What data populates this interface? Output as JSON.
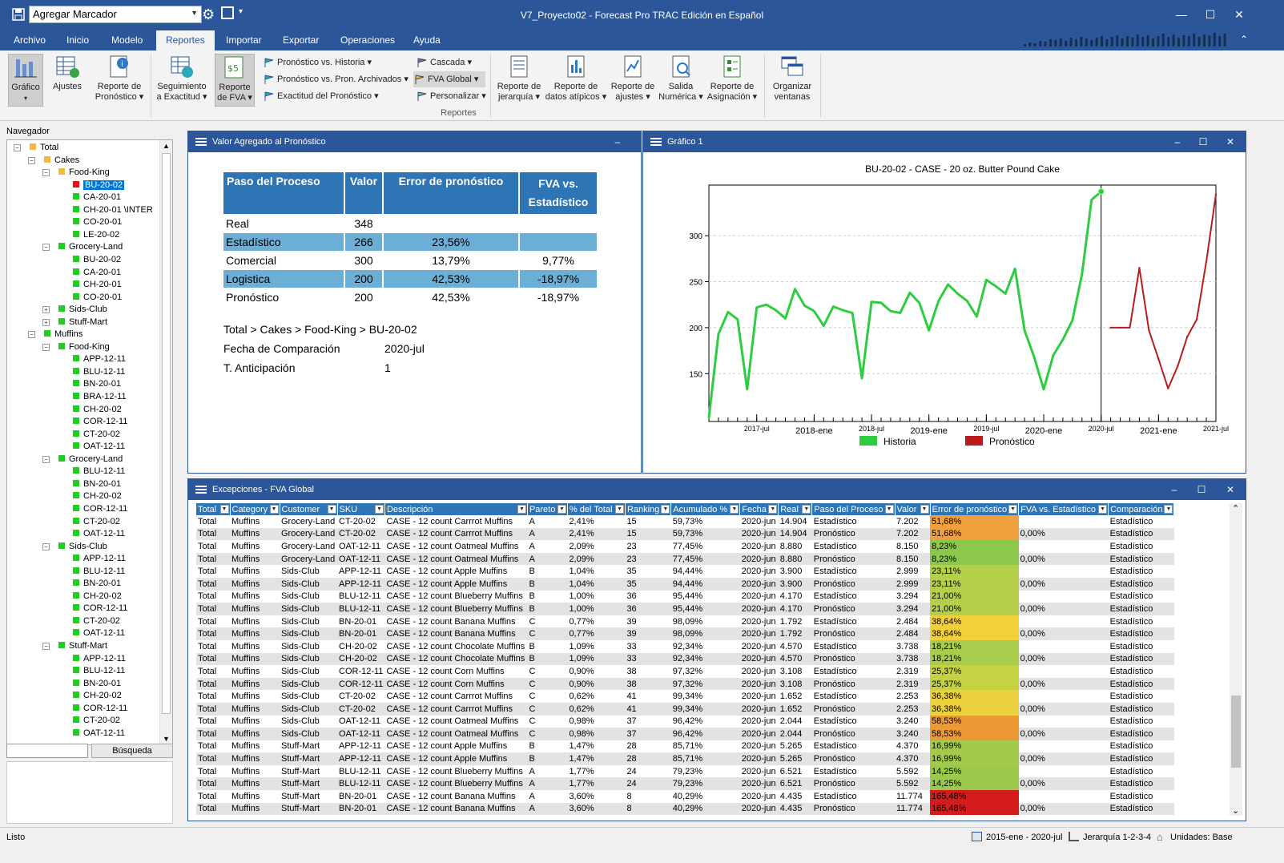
{
  "app": {
    "title": "V7_Proyecto02 - Forecast Pro TRAC Edición en Español",
    "quick_access_value": "Agregar Marcador",
    "colors": {
      "accent": "#2b579a",
      "header_blue": "#2e75b6",
      "row_blue": "#6baed6",
      "history_green": "#2ecc40",
      "forecast_red": "#b81c1c"
    }
  },
  "menu_tabs": [
    "Archivo",
    "Inicio",
    "Modelo",
    "Reportes",
    "Importar",
    "Exportar",
    "Operaciones",
    "Ayuda"
  ],
  "active_tab": "Reportes",
  "ribbon": {
    "grafico": "Gráfico",
    "ajustes": "Ajustes",
    "reporte_pronostico": [
      "Reporte de",
      "Pronóstico ▾"
    ],
    "seguimiento": [
      "Seguimiento",
      "a Exactitud ▾"
    ],
    "reporte_fva": [
      "Reporte",
      "de FVA ▾"
    ],
    "small": [
      "Pronóstico vs. Historia ▾",
      "Pronóstico vs. Pron. Archivados ▾",
      "Exactitud del Pronóstico ▾",
      "Cascada ▾",
      "FVA Global ▾",
      "Personalizar ▾"
    ],
    "jerarquia": [
      "Reporte de",
      "jerarquía ▾"
    ],
    "atipicos": [
      "Reporte de",
      "datos atípicos ▾"
    ],
    "ajustes_rep": [
      "Reporte de",
      "ajustes ▾"
    ],
    "salida": [
      "Salida",
      "Numérica ▾"
    ],
    "asignacion": [
      "Reporte de",
      "Asignación ▾"
    ],
    "organizar": [
      "Organizar",
      "ventanas"
    ],
    "group_label": "Reportes"
  },
  "navigator": {
    "title": "Navegador",
    "search_button": "Búsqueda",
    "nodes": [
      {
        "label": "Total",
        "level": 0,
        "color": "#f5b942",
        "exp": "−"
      },
      {
        "label": "Cakes",
        "level": 1,
        "color": "#f5b942",
        "exp": "−"
      },
      {
        "label": "Food-King",
        "level": 2,
        "color": "#f5b942",
        "exp": "−"
      },
      {
        "label": "BU-20-02",
        "level": 3,
        "color": "#e81010",
        "selected": true
      },
      {
        "label": "CA-20-01",
        "level": 3,
        "color": "#22cc22"
      },
      {
        "label": "CH-20-01 \\INTER",
        "level": 3,
        "color": "#22cc22"
      },
      {
        "label": "CO-20-01",
        "level": 3,
        "color": "#22cc22"
      },
      {
        "label": "LE-20-02",
        "level": 3,
        "color": "#22cc22"
      },
      {
        "label": "Grocery-Land",
        "level": 2,
        "color": "#22cc22",
        "exp": "−"
      },
      {
        "label": "BU-20-02",
        "level": 3,
        "color": "#22cc22"
      },
      {
        "label": "CA-20-01",
        "level": 3,
        "color": "#22cc22"
      },
      {
        "label": "CH-20-01",
        "level": 3,
        "color": "#22cc22"
      },
      {
        "label": "CO-20-01",
        "level": 3,
        "color": "#22cc22"
      },
      {
        "label": "Sids-Club",
        "level": 2,
        "color": "#22cc22",
        "exp": "+"
      },
      {
        "label": "Stuff-Mart",
        "level": 2,
        "color": "#22cc22",
        "exp": "+"
      },
      {
        "label": "Muffins",
        "level": 1,
        "color": "#22cc22",
        "exp": "−"
      },
      {
        "label": "Food-King",
        "level": 2,
        "color": "#22cc22",
        "exp": "−"
      },
      {
        "label": "APP-12-11",
        "level": 3,
        "color": "#22cc22"
      },
      {
        "label": "BLU-12-11",
        "level": 3,
        "color": "#22cc22"
      },
      {
        "label": "BN-20-01",
        "level": 3,
        "color": "#22cc22"
      },
      {
        "label": "BRA-12-11",
        "level": 3,
        "color": "#22cc22"
      },
      {
        "label": "CH-20-02",
        "level": 3,
        "color": "#22cc22"
      },
      {
        "label": "COR-12-11",
        "level": 3,
        "color": "#22cc22"
      },
      {
        "label": "CT-20-02",
        "level": 3,
        "color": "#22cc22"
      },
      {
        "label": "OAT-12-11",
        "level": 3,
        "color": "#22cc22"
      },
      {
        "label": "Grocery-Land",
        "level": 2,
        "color": "#22cc22",
        "exp": "−"
      },
      {
        "label": "BLU-12-11",
        "level": 3,
        "color": "#22cc22"
      },
      {
        "label": "BN-20-01",
        "level": 3,
        "color": "#22cc22"
      },
      {
        "label": "CH-20-02",
        "level": 3,
        "color": "#22cc22"
      },
      {
        "label": "COR-12-11",
        "level": 3,
        "color": "#22cc22"
      },
      {
        "label": "CT-20-02",
        "level": 3,
        "color": "#22cc22"
      },
      {
        "label": "OAT-12-11",
        "level": 3,
        "color": "#22cc22"
      },
      {
        "label": "Sids-Club",
        "level": 2,
        "color": "#22cc22",
        "exp": "−"
      },
      {
        "label": "APP-12-11",
        "level": 3,
        "color": "#22cc22"
      },
      {
        "label": "BLU-12-11",
        "level": 3,
        "color": "#22cc22"
      },
      {
        "label": "BN-20-01",
        "level": 3,
        "color": "#22cc22"
      },
      {
        "label": "CH-20-02",
        "level": 3,
        "color": "#22cc22"
      },
      {
        "label": "COR-12-11",
        "level": 3,
        "color": "#22cc22"
      },
      {
        "label": "CT-20-02",
        "level": 3,
        "color": "#22cc22"
      },
      {
        "label": "OAT-12-11",
        "level": 3,
        "color": "#22cc22"
      },
      {
        "label": "Stuff-Mart",
        "level": 2,
        "color": "#22cc22",
        "exp": "−"
      },
      {
        "label": "APP-12-11",
        "level": 3,
        "color": "#22cc22"
      },
      {
        "label": "BLU-12-11",
        "level": 3,
        "color": "#22cc22"
      },
      {
        "label": "BN-20-01",
        "level": 3,
        "color": "#22cc22"
      },
      {
        "label": "CH-20-02",
        "level": 3,
        "color": "#22cc22"
      },
      {
        "label": "COR-12-11",
        "level": 3,
        "color": "#22cc22"
      },
      {
        "label": "CT-20-02",
        "level": 3,
        "color": "#22cc22"
      },
      {
        "label": "OAT-12-11",
        "level": 3,
        "color": "#22cc22"
      }
    ]
  },
  "fva_panel": {
    "title": "Valor Agregado al Pronóstico",
    "headers": [
      "Paso del Proceso",
      "Valor",
      "Error de pronóstico",
      "FVA vs. Estadístico"
    ],
    "rows": [
      [
        "Real",
        "348",
        "",
        ""
      ],
      [
        "Estadístico",
        "266",
        "23,56%",
        ""
      ],
      [
        "Comercial",
        "300",
        "13,79%",
        "9,77%"
      ],
      [
        "Logistica",
        "200",
        "42,53%",
        "-18,97%"
      ],
      [
        "Pronóstico",
        "200",
        "42,53%",
        "-18,97%"
      ]
    ],
    "path": "Total > Cakes > Food-King > BU-20-02",
    "comp_label": "Fecha de Comparación",
    "comp_value": "2020-jul",
    "lead_label": "T. Anticipación",
    "lead_value": "1"
  },
  "chart_panel": {
    "title": "Gráfico 1"
  },
  "chart_data": {
    "type": "line",
    "title": "BU-20-02 - CASE - 20 oz. Butter Pound Cake",
    "xlabel": "",
    "ylabel": "",
    "y_ticks": [
      "150",
      "200",
      "250",
      "300"
    ],
    "x_ticks": [
      "2017-jul",
      "2018-ene",
      "2018-jul",
      "2019-ene",
      "2019-jul",
      "2020-ene",
      "2020-jul",
      "2021-ene",
      "2021-jul"
    ],
    "ylim": [
      98,
      355
    ],
    "grid": true,
    "legend_position": "bottom",
    "series": [
      {
        "name": "Historia",
        "color": "#2ecc40",
        "x": [
          "2017-feb",
          "2017-mar",
          "2017-abr",
          "2017-may",
          "2017-jun",
          "2017-jul",
          "2017-ago",
          "2017-sep",
          "2017-oct",
          "2017-nov",
          "2017-dic",
          "2018-ene",
          "2018-feb",
          "2018-mar",
          "2018-abr",
          "2018-may",
          "2018-jun",
          "2018-jul",
          "2018-ago",
          "2018-sep",
          "2018-oct",
          "2018-nov",
          "2018-dic",
          "2019-ene",
          "2019-feb",
          "2019-mar",
          "2019-abr",
          "2019-may",
          "2019-jun",
          "2019-jul",
          "2019-ago",
          "2019-sep",
          "2019-oct",
          "2019-nov",
          "2019-dic",
          "2020-ene",
          "2020-feb",
          "2020-mar",
          "2020-abr",
          "2020-may",
          "2020-jun",
          "2020-jul"
        ],
        "values": [
          102,
          193,
          217,
          209,
          133,
          222,
          225,
          219,
          210,
          242,
          224,
          218,
          202,
          223,
          219,
          216,
          145,
          228,
          227,
          218,
          216,
          238,
          227,
          197,
          229,
          247,
          237,
          229,
          212,
          252,
          245,
          237,
          264,
          197,
          168,
          133,
          170,
          187,
          208,
          258,
          339,
          348
        ]
      },
      {
        "name": "Pronóstico",
        "color": "#b81c1c",
        "x": [
          "2020-ago",
          "2020-sep",
          "2020-oct",
          "2020-nov",
          "2020-dic",
          "2021-ene",
          "2021-feb",
          "2021-mar",
          "2021-abr",
          "2021-may",
          "2021-jun",
          "2021-jul"
        ],
        "values": [
          200,
          200,
          200,
          265,
          197,
          166,
          134,
          158,
          190,
          209,
          272,
          345
        ]
      }
    ]
  },
  "exceptions_panel": {
    "title": "Excepciones - FVA Global",
    "columns": [
      "Total",
      "Category",
      "Customer",
      "SKU",
      "Descripción",
      "Pareto",
      "% del Total",
      "Ranking",
      "Acumulado %",
      "Fecha",
      "Real",
      "Paso del Proceso",
      "Valor",
      "Error de pronóstico",
      "FVA vs. Estadístico",
      "Comparación"
    ],
    "rows": [
      [
        "Total",
        "Muffins",
        "Grocery-Land",
        "CT-20-02",
        "CASE - 12 count Carrrot Muffins",
        "A",
        "2,41%",
        "15",
        "59,73%",
        "2020-jun",
        "14.904",
        "Estadístico",
        "7.202",
        "51,68%",
        "",
        "Estadístico",
        "#f0a03c"
      ],
      [
        "Total",
        "Muffins",
        "Grocery-Land",
        "CT-20-02",
        "CASE - 12 count Carrrot Muffins",
        "A",
        "2,41%",
        "15",
        "59,73%",
        "2020-jun",
        "14.904",
        "Pronóstico",
        "7.202",
        "51,68%",
        "0,00%",
        "Estadístico",
        "#f0a03c"
      ],
      [
        "Total",
        "Muffins",
        "Grocery-Land",
        "OAT-12-11",
        "CASE - 12 count Oatmeal Muffins",
        "A",
        "2,09%",
        "23",
        "77,45%",
        "2020-jun",
        "8.880",
        "Estadístico",
        "8.150",
        "8,23%",
        "",
        "Estadístico",
        "#8cc84b"
      ],
      [
        "Total",
        "Muffins",
        "Grocery-Land",
        "OAT-12-11",
        "CASE - 12 count Oatmeal Muffins",
        "A",
        "2,09%",
        "23",
        "77,45%",
        "2020-jun",
        "8.880",
        "Pronóstico",
        "8.150",
        "8,23%",
        "0,00%",
        "Estadístico",
        "#8cc84b"
      ],
      [
        "Total",
        "Muffins",
        "Sids-Club",
        "APP-12-11",
        "CASE - 12 count Apple Muffins",
        "B",
        "1,04%",
        "35",
        "94,44%",
        "2020-jun",
        "3.900",
        "Estadístico",
        "2.999",
        "23,11%",
        "",
        "Estadístico",
        "#b5cf4a"
      ],
      [
        "Total",
        "Muffins",
        "Sids-Club",
        "APP-12-11",
        "CASE - 12 count Apple Muffins",
        "B",
        "1,04%",
        "35",
        "94,44%",
        "2020-jun",
        "3.900",
        "Pronóstico",
        "2.999",
        "23,11%",
        "0,00%",
        "Estadístico",
        "#b5cf4a"
      ],
      [
        "Total",
        "Muffins",
        "Sids-Club",
        "BLU-12-11",
        "CASE - 12 count Blueberry Muffins",
        "B",
        "1,00%",
        "36",
        "95,44%",
        "2020-jun",
        "4.170",
        "Estadístico",
        "3.294",
        "21,00%",
        "",
        "Estadístico",
        "#b5cf4a"
      ],
      [
        "Total",
        "Muffins",
        "Sids-Club",
        "BLU-12-11",
        "CASE - 12 count Blueberry Muffins",
        "B",
        "1,00%",
        "36",
        "95,44%",
        "2020-jun",
        "4.170",
        "Pronóstico",
        "3.294",
        "21,00%",
        "0,00%",
        "Estadístico",
        "#b5cf4a"
      ],
      [
        "Total",
        "Muffins",
        "Sids-Club",
        "BN-20-01",
        "CASE - 12 count Banana Muffins",
        "C",
        "0,77%",
        "39",
        "98,09%",
        "2020-jun",
        "1.792",
        "Estadístico",
        "2.484",
        "38,64%",
        "",
        "Estadístico",
        "#f2d03c"
      ],
      [
        "Total",
        "Muffins",
        "Sids-Club",
        "BN-20-01",
        "CASE - 12 count Banana Muffins",
        "C",
        "0,77%",
        "39",
        "98,09%",
        "2020-jun",
        "1.792",
        "Pronóstico",
        "2.484",
        "38,64%",
        "0,00%",
        "Estadístico",
        "#f2d03c"
      ],
      [
        "Total",
        "Muffins",
        "Sids-Club",
        "CH-20-02",
        "CASE - 12 count Chocolate Muffins",
        "B",
        "1,09%",
        "33",
        "92,34%",
        "2020-jun",
        "4.570",
        "Estadístico",
        "3.738",
        "18,21%",
        "",
        "Estadístico",
        "#a8cc4c"
      ],
      [
        "Total",
        "Muffins",
        "Sids-Club",
        "CH-20-02",
        "CASE - 12 count Chocolate Muffins",
        "B",
        "1,09%",
        "33",
        "92,34%",
        "2020-jun",
        "4.570",
        "Pronóstico",
        "3.738",
        "18,21%",
        "0,00%",
        "Estadístico",
        "#a8cc4c"
      ],
      [
        "Total",
        "Muffins",
        "Sids-Club",
        "COR-12-11",
        "CASE - 12 count Corn Muffins",
        "C",
        "0,90%",
        "38",
        "97,32%",
        "2020-jun",
        "3.108",
        "Estadístico",
        "2.319",
        "25,37%",
        "",
        "Estadístico",
        "#c4d244"
      ],
      [
        "Total",
        "Muffins",
        "Sids-Club",
        "COR-12-11",
        "CASE - 12 count Corn Muffins",
        "C",
        "0,90%",
        "38",
        "97,32%",
        "2020-jun",
        "3.108",
        "Pronóstico",
        "2.319",
        "25,37%",
        "0,00%",
        "Estadístico",
        "#c4d244"
      ],
      [
        "Total",
        "Muffins",
        "Sids-Club",
        "CT-20-02",
        "CASE - 12 count Carrrot Muffins",
        "C",
        "0,62%",
        "41",
        "99,34%",
        "2020-jun",
        "1.652",
        "Estadístico",
        "2.253",
        "36,38%",
        "",
        "Estadístico",
        "#ecd13e"
      ],
      [
        "Total",
        "Muffins",
        "Sids-Club",
        "CT-20-02",
        "CASE - 12 count Carrrot Muffins",
        "C",
        "0,62%",
        "41",
        "99,34%",
        "2020-jun",
        "1.652",
        "Pronóstico",
        "2.253",
        "36,38%",
        "0,00%",
        "Estadístico",
        "#ecd13e"
      ],
      [
        "Total",
        "Muffins",
        "Sids-Club",
        "OAT-12-11",
        "CASE - 12 count Oatmeal Muffins",
        "C",
        "0,98%",
        "37",
        "96,42%",
        "2020-jun",
        "2.044",
        "Estadístico",
        "3.240",
        "58,53%",
        "",
        "Estadístico",
        "#ed9a36"
      ],
      [
        "Total",
        "Muffins",
        "Sids-Club",
        "OAT-12-11",
        "CASE - 12 count Oatmeal Muffins",
        "C",
        "0,98%",
        "37",
        "96,42%",
        "2020-jun",
        "2.044",
        "Pronóstico",
        "3.240",
        "58,53%",
        "0,00%",
        "Estadístico",
        "#ed9a36"
      ],
      [
        "Total",
        "Muffins",
        "Stuff-Mart",
        "APP-12-11",
        "CASE - 12 count Apple Muffins",
        "B",
        "1,47%",
        "28",
        "85,71%",
        "2020-jun",
        "5.265",
        "Estadístico",
        "4.370",
        "16,99%",
        "",
        "Estadístico",
        "#a3ca4c"
      ],
      [
        "Total",
        "Muffins",
        "Stuff-Mart",
        "APP-12-11",
        "CASE - 12 count Apple Muffins",
        "B",
        "1,47%",
        "28",
        "85,71%",
        "2020-jun",
        "5.265",
        "Pronóstico",
        "4.370",
        "16,99%",
        "0,00%",
        "Estadístico",
        "#a3ca4c"
      ],
      [
        "Total",
        "Muffins",
        "Stuff-Mart",
        "BLU-12-11",
        "CASE - 12 count Blueberry Muffins",
        "A",
        "1,77%",
        "24",
        "79,23%",
        "2020-jun",
        "6.521",
        "Estadístico",
        "5.592",
        "14,25%",
        "",
        "Estadístico",
        "#9cc94c"
      ],
      [
        "Total",
        "Muffins",
        "Stuff-Mart",
        "BLU-12-11",
        "CASE - 12 count Blueberry Muffins",
        "A",
        "1,77%",
        "24",
        "79,23%",
        "2020-jun",
        "6.521",
        "Pronóstico",
        "5.592",
        "14,25%",
        "0,00%",
        "Estadístico",
        "#9cc94c"
      ],
      [
        "Total",
        "Muffins",
        "Stuff-Mart",
        "BN-20-01",
        "CASE - 12 count Banana Muffins",
        "A",
        "3,60%",
        "8",
        "40,29%",
        "2020-jun",
        "4.435",
        "Estadístico",
        "11.774",
        "165,48%",
        "",
        "Estadístico",
        "#d41c1c"
      ],
      [
        "Total",
        "Muffins",
        "Stuff-Mart",
        "BN-20-01",
        "CASE - 12 count Banana Muffins",
        "A",
        "3,60%",
        "8",
        "40,29%",
        "2020-jun",
        "4.435",
        "Pronóstico",
        "11.774",
        "165,48%",
        "0,00%",
        "Estadístico",
        "#d41c1c"
      ]
    ]
  },
  "statusbar": {
    "left": "Listo",
    "range": "2015-ene - 2020-jul",
    "hierarchy": "Jerarquía 1-2-3-4",
    "units": "Unidades: Base"
  }
}
